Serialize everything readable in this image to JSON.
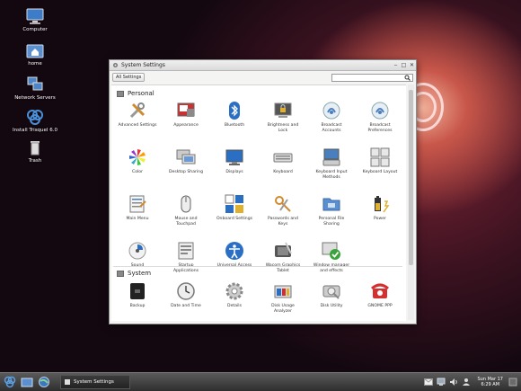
{
  "desktop": {
    "icons": [
      {
        "label": "Computer"
      },
      {
        "label": "home"
      },
      {
        "label": "Network Servers"
      },
      {
        "label": "Install Trisquel 6.0"
      },
      {
        "label": "Trash"
      }
    ]
  },
  "window": {
    "title": "System Settings",
    "all_settings_label": "All Settings",
    "search_value": "",
    "sections": [
      {
        "title": "Personal",
        "items": [
          {
            "label": "Advanced Settings",
            "icon": "tools-icon"
          },
          {
            "label": "Appearance",
            "icon": "appearance-icon"
          },
          {
            "label": "Bluetooth",
            "icon": "bluetooth-icon"
          },
          {
            "label": "Brightness and\nLock",
            "icon": "lock-screen-icon"
          },
          {
            "label": "Broadcast\nAccounts",
            "icon": "broadcast-icon"
          },
          {
            "label": "Broadcast\nPreferences",
            "icon": "broadcast-icon"
          },
          {
            "label": "Color",
            "icon": "color-icon"
          },
          {
            "label": "Desktop Sharing",
            "icon": "desktop-sharing-icon"
          },
          {
            "label": "Displays",
            "icon": "display-icon"
          },
          {
            "label": "Keyboard",
            "icon": "keyboard-icon"
          },
          {
            "label": "Keyboard Input\nMethods",
            "icon": "keyboard-input-icon"
          },
          {
            "label": "Keyboard Layout",
            "icon": "keyboard-layout-icon"
          },
          {
            "label": "Main Menu",
            "icon": "main-menu-icon"
          },
          {
            "label": "Mouse and\nTouchpad",
            "icon": "mouse-icon"
          },
          {
            "label": "Onboard Settings",
            "icon": "onboard-icon"
          },
          {
            "label": "Passwords and\nKeys",
            "icon": "keys-icon"
          },
          {
            "label": "Personal File\nSharing",
            "icon": "folder-sharing-icon"
          },
          {
            "label": "Power",
            "icon": "power-icon"
          },
          {
            "label": "Sound",
            "icon": "sound-icon"
          },
          {
            "label": "Startup\nApplications",
            "icon": "startup-icon"
          },
          {
            "label": "Universal Access",
            "icon": "accessibility-icon"
          },
          {
            "label": "Wacom Graphics\nTablet",
            "icon": "tablet-icon"
          },
          {
            "label": "Window manager\nand effects",
            "icon": "window-manager-icon"
          }
        ]
      },
      {
        "title": "System",
        "items": [
          {
            "label": "Backup",
            "icon": "backup-icon"
          },
          {
            "label": "Date and Time",
            "icon": "clock-icon"
          },
          {
            "label": "Details",
            "icon": "gear-icon"
          },
          {
            "label": "Disk Usage\nAnalyzer",
            "icon": "disk-usage-icon"
          },
          {
            "label": "Disk Utility",
            "icon": "disk-utility-icon"
          },
          {
            "label": "GNOME PPP",
            "icon": "phone-icon"
          }
        ]
      }
    ]
  },
  "taskbar": {
    "task_label": "System Settings",
    "clock_line1": "Sun Mar 17",
    "clock_line2": "6:29 AM"
  },
  "colors": {
    "accent_blue": "#2a6fc4",
    "window_bg": "#f4f4f3"
  }
}
